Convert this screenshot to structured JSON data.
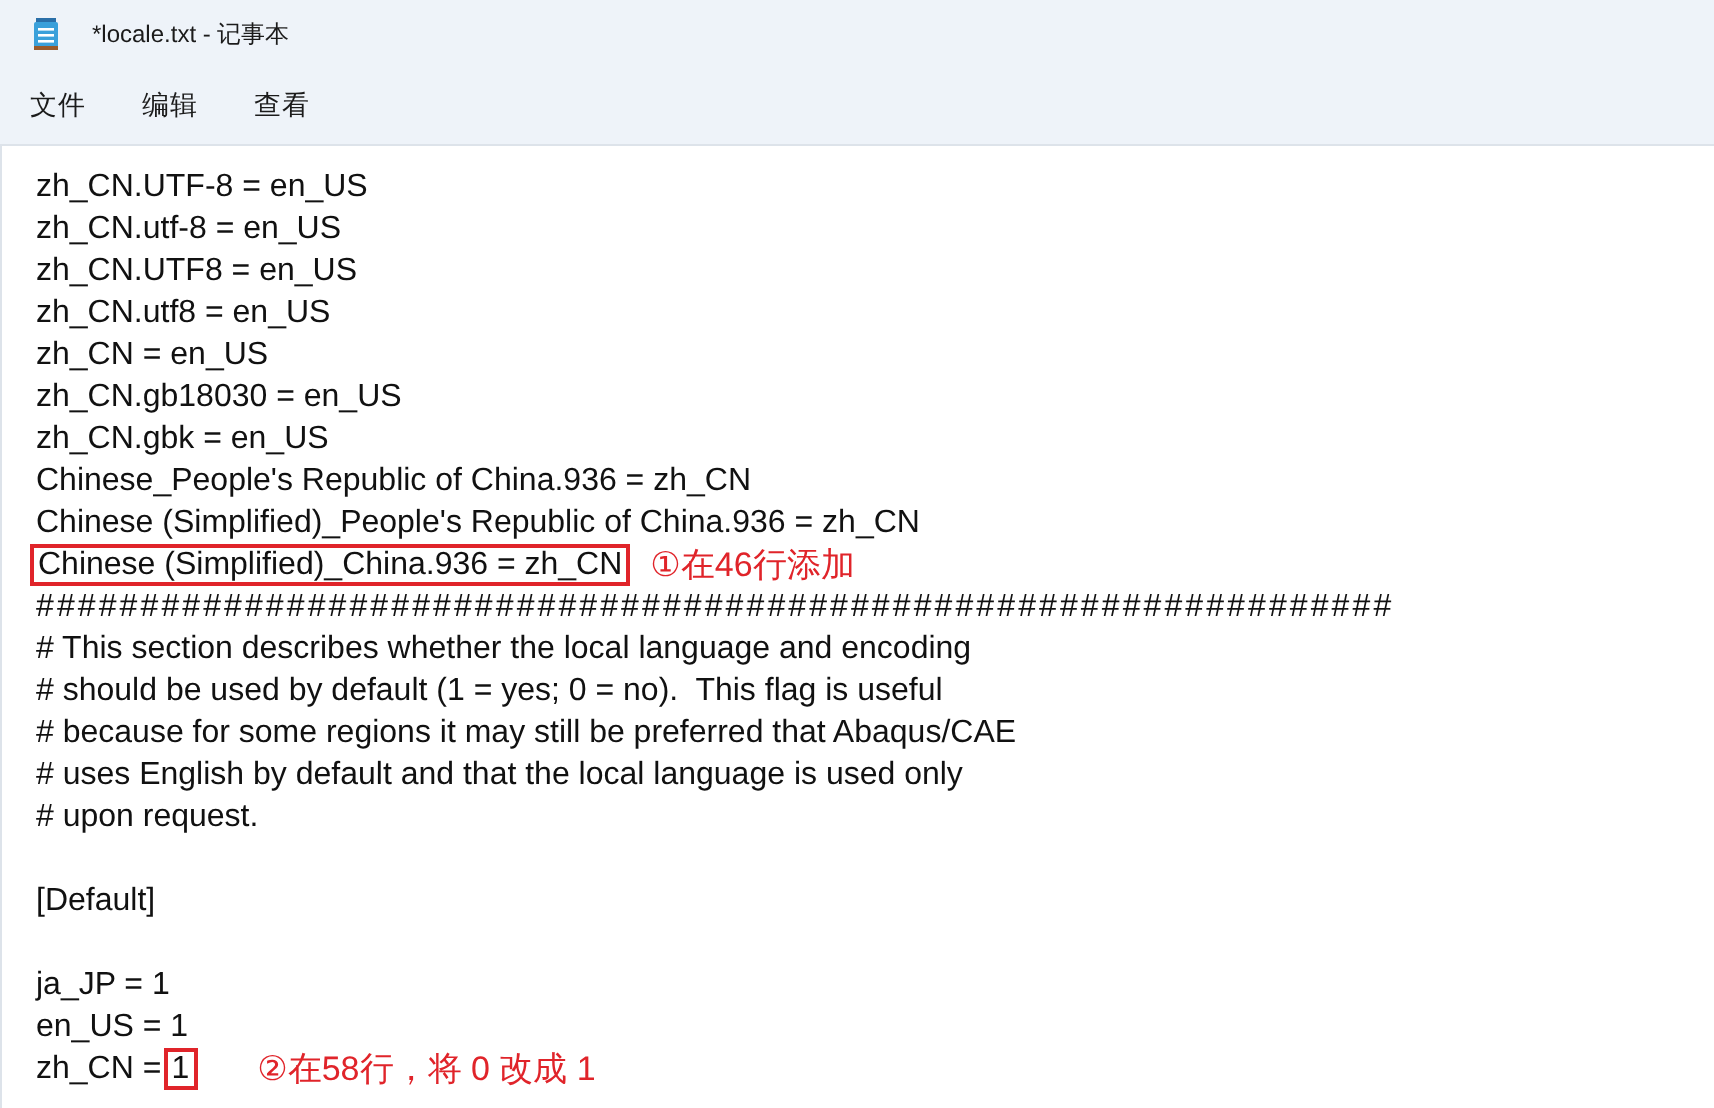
{
  "window": {
    "title": "*locale.txt - 记事本"
  },
  "menu": [
    "文件",
    "编辑",
    "查看"
  ],
  "lines": [
    {
      "kind": "text",
      "text": "zh_CN.UTF-8 = en_US"
    },
    {
      "kind": "text",
      "text": "zh_CN.utf-8 = en_US"
    },
    {
      "kind": "text",
      "text": "zh_CN.UTF8 = en_US"
    },
    {
      "kind": "text",
      "text": "zh_CN.utf8 = en_US"
    },
    {
      "kind": "text",
      "text": "zh_CN = en_US"
    },
    {
      "kind": "text",
      "text": "zh_CN.gb18030 = en_US"
    },
    {
      "kind": "text",
      "text": "zh_CN.gbk = en_US"
    },
    {
      "kind": "text",
      "text": "Chinese_People's Republic of China.936 = zh_CN"
    },
    {
      "kind": "text",
      "text": "Chinese (Simplified)_People's Republic of China.936 = zh_CN"
    },
    {
      "kind": "text",
      "boxed": "Chinese (Simplified)_China.936 = zh_CN",
      "note": "①在46行添加"
    },
    {
      "kind": "text",
      "text": "#################################################################"
    },
    {
      "kind": "text",
      "text": "# This section describes whether the local language and encoding"
    },
    {
      "kind": "text",
      "text": "# should be used by default (1 = yes; 0 = no).  This flag is useful"
    },
    {
      "kind": "text",
      "text": "# because for some regions it may still be preferred that Abaqus/CAE"
    },
    {
      "kind": "text",
      "text": "# uses English by default and that the local language is used only"
    },
    {
      "kind": "text",
      "text": "# upon request."
    },
    {
      "kind": "blank"
    },
    {
      "kind": "text",
      "text": "[Default]"
    },
    {
      "kind": "blank"
    },
    {
      "kind": "text",
      "text": "ja_JP = 1"
    },
    {
      "kind": "text",
      "text": "en_US = 1"
    },
    {
      "kind": "text",
      "text": "zh_CN =",
      "boxed": "1",
      "note": "②在58行，将 0 改成 1"
    }
  ]
}
